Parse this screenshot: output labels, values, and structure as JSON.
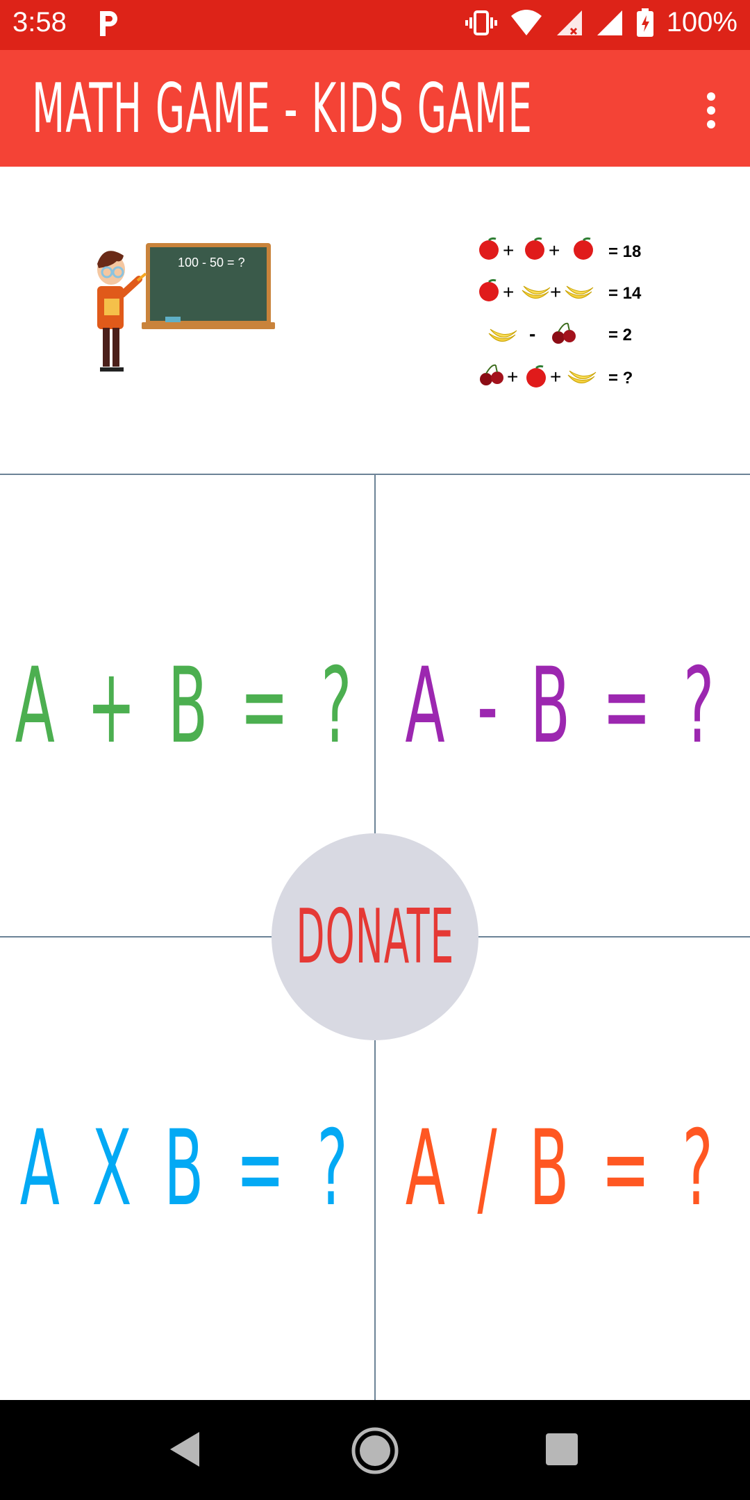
{
  "status_bar": {
    "time": "3:58",
    "battery": "100%"
  },
  "app_bar": {
    "title": "MATH GAME - KIDS GAME"
  },
  "banner": {
    "chalkboard_text": "100 - 50 = ?",
    "puzzle": [
      {
        "items": [
          "apple",
          "+",
          "apple",
          "+",
          "apple"
        ],
        "result": "= 18"
      },
      {
        "items": [
          "apple",
          "+",
          "banana",
          "+",
          "banana"
        ],
        "result": "= 14"
      },
      {
        "items": [
          "banana",
          "-",
          "cherry"
        ],
        "result": "= 2"
      },
      {
        "items": [
          "cherry",
          "+",
          "apple",
          "+",
          "banana"
        ],
        "result": "= ?"
      }
    ]
  },
  "games": {
    "addition": {
      "label": "A + B = ?",
      "color": "#4caf50"
    },
    "subtraction": {
      "label": "A - B = ?",
      "color": "#9c27b0"
    },
    "multiplication": {
      "label": "A X B = ?",
      "color": "#03a9f4"
    },
    "division": {
      "label": "A / B = ?",
      "color": "#ff5722"
    }
  },
  "donate": {
    "label": "DONATE",
    "color": "#e53935"
  }
}
